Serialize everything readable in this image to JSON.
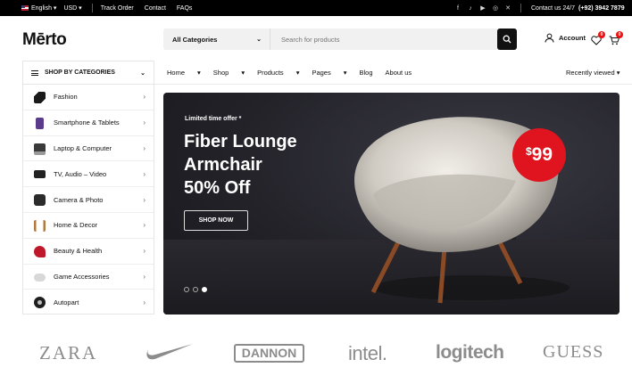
{
  "topbar": {
    "language": "English",
    "currency": "USD",
    "links": [
      "Track Order",
      "Contact",
      "FAQs"
    ],
    "social_icons": [
      "facebook-icon",
      "tiktok-icon",
      "youtube-icon",
      "instagram-icon",
      "x-icon"
    ],
    "contact_label": "Contact us 24/7",
    "phone": "(+92) 3942 7879"
  },
  "header": {
    "logo": "Mērto",
    "search_category": "All Categories",
    "search_placeholder": "Search for products",
    "account_label": "Account",
    "wishlist_count": "0",
    "cart_count": "0"
  },
  "nav": {
    "categories_label": "SHOP BY CATEGORIES",
    "items": [
      "Home",
      "Shop",
      "Products",
      "Pages",
      "Blog",
      "About us"
    ],
    "recent_label": "Recently viewed"
  },
  "categories": [
    {
      "label": "Fashion",
      "color": "#1a1a1a"
    },
    {
      "label": "Smartphone & Tablets",
      "color": "#5b3b8c"
    },
    {
      "label": "Laptop & Computer",
      "color": "#3a3a3a"
    },
    {
      "label": "TV, Audio – Video",
      "color": "#222222"
    },
    {
      "label": "Camera & Photo",
      "color": "#2b2b2b"
    },
    {
      "label": "Home & Decor",
      "color": "#b07a3e"
    },
    {
      "label": "Beauty & Health",
      "color": "#c0182b"
    },
    {
      "label": "Game Accessories",
      "color": "#d8d8d8"
    },
    {
      "label": "Autopart",
      "color": "#1e1e1e"
    }
  ],
  "hero": {
    "tag": "Limited time offer *",
    "title_line1": "Fiber Lounge",
    "title_line2": "Armchair",
    "title_line3": "50% Off",
    "cta": "SHOP NOW",
    "price_symbol": "$",
    "price_value": "99",
    "slide_active": 3,
    "slide_count": 3
  },
  "brands": [
    "ZARA",
    "nike",
    "DANNON",
    "intel.",
    "logitech",
    "GUESS"
  ],
  "colors": {
    "accent": "#e0141e",
    "dark": "#111111",
    "topbar": "#000000"
  }
}
